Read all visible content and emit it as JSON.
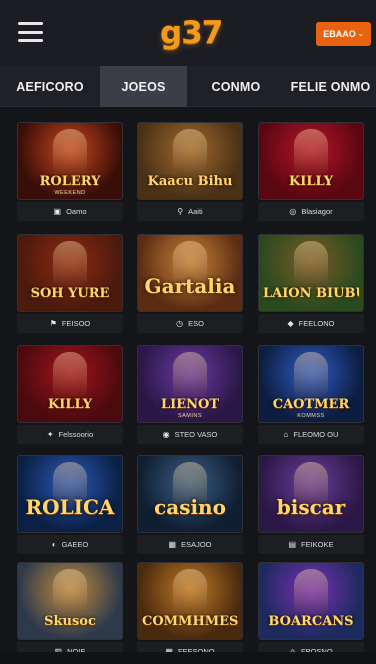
{
  "header": {
    "logo_text": "g37",
    "cta_label": "EBAAO",
    "cta_chevron": "⌄"
  },
  "tabs": [
    {
      "label": "AEFICORO"
    },
    {
      "label": "JOEOS",
      "active": true
    },
    {
      "label": "CONMO"
    },
    {
      "label": "FELIE ONMO"
    }
  ],
  "games": [
    {
      "title": "ROLERY",
      "subtitle": "WEEKEND",
      "caption": "Oamo",
      "icon": "tablet-icon",
      "glyph": "▣",
      "bg": "#3a0e08",
      "accent": "#c9461c"
    },
    {
      "title": "Kaacu Bihu",
      "subtitle": "",
      "caption": "Aaiti",
      "icon": "run-icon",
      "glyph": "⚲",
      "bg": "#4a3116",
      "accent": "#a26a2d"
    },
    {
      "title": "KILLY",
      "subtitle": "",
      "caption": "Blasiagor",
      "icon": "camera-icon",
      "glyph": "◎",
      "bg": "#5a0710",
      "accent": "#b7152a"
    },
    {
      "title": "SOH YURE",
      "subtitle": "",
      "caption": "FEISOO",
      "icon": "bookmark-icon",
      "glyph": "⚑",
      "bg": "#4a1a0d",
      "accent": "#8f2a12"
    },
    {
      "title": "Gartalia",
      "subtitle": "",
      "caption": "ESO",
      "icon": "clock-icon",
      "glyph": "◷",
      "bg": "#5b2c12",
      "accent": "#c9833a"
    },
    {
      "title": "LAION BIUBU",
      "subtitle": "",
      "caption": "FEELONO",
      "icon": "tag-icon",
      "glyph": "◆",
      "bg": "#2a4a1e",
      "accent": "#7a5b26"
    },
    {
      "title": "KILLY",
      "subtitle": "",
      "caption": "Felssoorio",
      "icon": "twitter-icon",
      "glyph": "✦",
      "bg": "#4b0a0e",
      "accent": "#a4151c"
    },
    {
      "title": "LIENOT",
      "subtitle": "SAMINS",
      "caption": "STEO VASO",
      "icon": "globe-icon",
      "glyph": "◉",
      "bg": "#2a1747",
      "accent": "#6b3aa2"
    },
    {
      "title": "CAOTMER",
      "subtitle": "KOMMSS",
      "caption": "FLEOMO OU",
      "icon": "lock-icon",
      "glyph": "⌂",
      "bg": "#0c1d3f",
      "accent": "#2e5cc7"
    },
    {
      "title": "ROLICA",
      "subtitle": "",
      "caption": "GAEEO",
      "icon": "refresh-icon",
      "glyph": "◐",
      "bg": "#0a2044",
      "accent": "#2a59b8"
    },
    {
      "title": "casino",
      "subtitle": "",
      "caption": "ESAJOO",
      "icon": "calendar-icon",
      "glyph": "▦",
      "bg": "#0f1e30",
      "accent": "#3a5f86"
    },
    {
      "title": "biscar",
      "subtitle": "",
      "caption": "FEIKOKE",
      "icon": "doc-icon",
      "glyph": "▤",
      "bg": "#2c1846",
      "accent": "#6a3d9c"
    },
    {
      "title": "Skusoc",
      "subtitle": "",
      "caption": "NOIE",
      "icon": "list-icon",
      "glyph": "▥",
      "bg": "#2e3a4a",
      "accent": "#c08a3e"
    },
    {
      "title": "COMMHMES",
      "subtitle": "",
      "caption": "FEESONO",
      "icon": "grid-icon",
      "glyph": "▦",
      "bg": "#4a2a0e",
      "accent": "#c17a26"
    },
    {
      "title": "BOARCANS",
      "subtitle": "",
      "caption": "FBOSNO",
      "icon": "star-icon",
      "glyph": "✧",
      "bg": "#1c2a5e",
      "accent": "#7b2fb4"
    }
  ]
}
